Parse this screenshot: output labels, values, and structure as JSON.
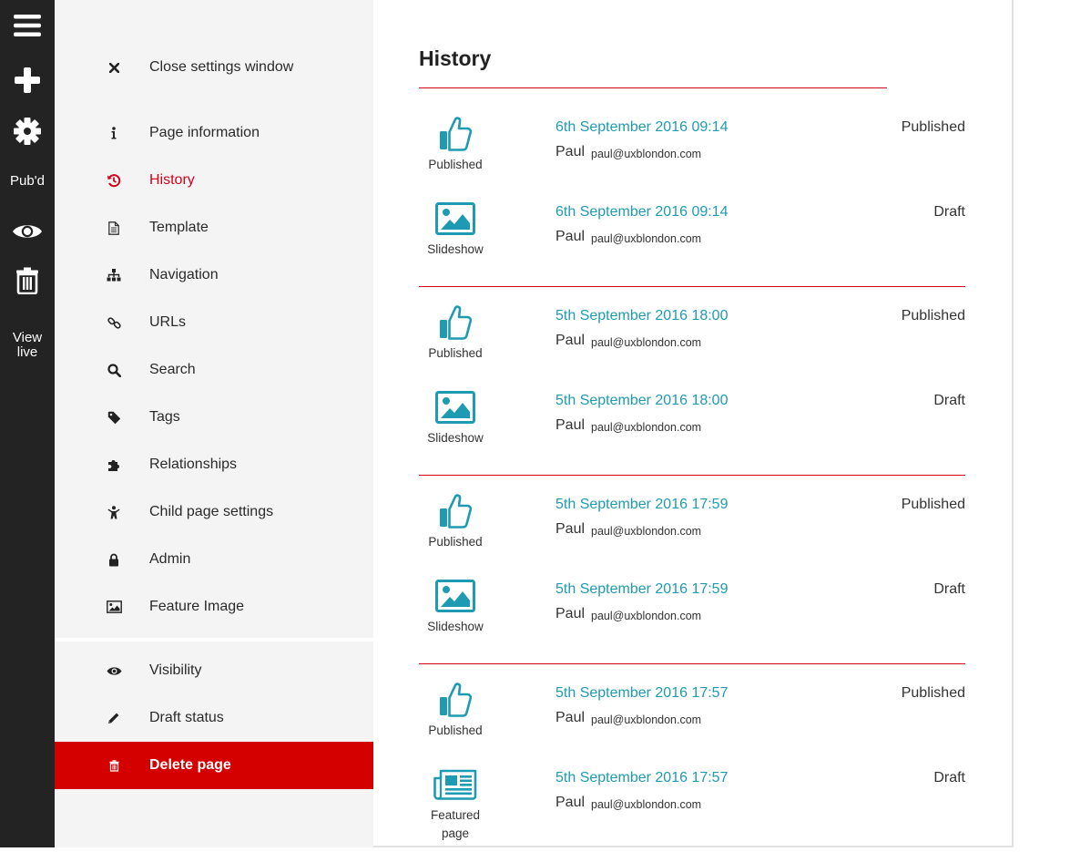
{
  "rail": {
    "status_label": "Pub'd",
    "view_live_label_1": "View",
    "view_live_label_2": "live",
    "icons": [
      "menu-icon",
      "plus-icon",
      "gear-icon",
      "eye-icon",
      "trash-icon"
    ]
  },
  "panel": {
    "items": [
      {
        "label": "Close settings window",
        "icon": "close-icon"
      },
      {
        "label": "Page information",
        "icon": "info-icon"
      },
      {
        "label": "History",
        "icon": "history-icon"
      },
      {
        "label": "Template",
        "icon": "document-icon"
      },
      {
        "label": "Navigation",
        "icon": "sitemap-icon"
      },
      {
        "label": "URLs",
        "icon": "link-icon"
      },
      {
        "label": "Search",
        "icon": "search-icon"
      },
      {
        "label": "Tags",
        "icon": "tag-icon"
      },
      {
        "label": "Relationships",
        "icon": "puzzle-icon"
      },
      {
        "label": "Child page settings",
        "icon": "child-icon"
      },
      {
        "label": "Admin",
        "icon": "lock-icon"
      },
      {
        "label": "Feature Image",
        "icon": "image-icon"
      },
      {
        "label": "Visibility",
        "icon": "eye-icon"
      },
      {
        "label": "Draft status",
        "icon": "pencil-icon"
      },
      {
        "label": "Delete page",
        "icon": "trash-icon"
      }
    ],
    "active_item": "History"
  },
  "main": {
    "title": "History",
    "groups": [
      {
        "entries": [
          {
            "icon": "thumbs-up-icon",
            "icon_label": "Published",
            "date": "6th September 2016 09:14",
            "user": "Paul",
            "email": "paul@uxblondon.com",
            "status": "Published"
          },
          {
            "icon": "image-icon",
            "icon_label": "Slideshow",
            "date": "6th September 2016 09:14",
            "user": "Paul",
            "email": "paul@uxblondon.com",
            "status": "Draft"
          }
        ]
      },
      {
        "entries": [
          {
            "icon": "thumbs-up-icon",
            "icon_label": "Published",
            "date": "5th September 2016 18:00",
            "user": "Paul",
            "email": "paul@uxblondon.com",
            "status": "Published"
          },
          {
            "icon": "image-icon",
            "icon_label": "Slideshow",
            "date": "5th September 2016 18:00",
            "user": "Paul",
            "email": "paul@uxblondon.com",
            "status": "Draft"
          }
        ]
      },
      {
        "entries": [
          {
            "icon": "thumbs-up-icon",
            "icon_label": "Published",
            "date": "5th September 2016 17:59",
            "user": "Paul",
            "email": "paul@uxblondon.com",
            "status": "Published"
          },
          {
            "icon": "image-icon",
            "icon_label": "Slideshow",
            "date": "5th September 2016 17:59",
            "user": "Paul",
            "email": "paul@uxblondon.com",
            "status": "Draft"
          }
        ]
      },
      {
        "entries": [
          {
            "icon": "thumbs-up-icon",
            "icon_label": "Published",
            "date": "5th September 2016 17:57",
            "user": "Paul",
            "email": "paul@uxblondon.com",
            "status": "Published"
          },
          {
            "icon": "newspaper-icon",
            "icon_label": "Featured page",
            "date": "5th September 2016 17:57",
            "user": "Paul",
            "email": "paul@uxblondon.com",
            "status": "Draft"
          }
        ]
      }
    ]
  },
  "colors": {
    "rail_bg": "#232323",
    "panel_bg": "#f4f4f4",
    "accent_red": "#d0021b",
    "delete_bg": "#d40000",
    "date_teal": "#1e9bb3",
    "icon_teal": "#1e9bb3"
  }
}
